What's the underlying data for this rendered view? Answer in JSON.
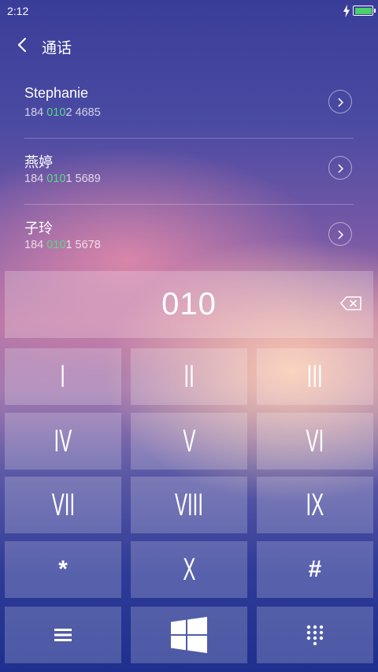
{
  "status": {
    "time": "2:12"
  },
  "header": {
    "title": "通话"
  },
  "contacts": [
    {
      "name": "Stephanie",
      "number_prefix": "184 ",
      "number_match": "010",
      "number_suffix": "2 4685"
    },
    {
      "name": "燕婷",
      "number_prefix": "184 ",
      "number_match": "010",
      "number_suffix": "1 5689"
    },
    {
      "name": "子玲",
      "number_prefix": "184 ",
      "number_match": "010",
      "number_suffix": "1 5678"
    }
  ],
  "dial": {
    "input": "010"
  },
  "keys": [
    "I",
    "II",
    "III",
    "IV",
    "V",
    "VI",
    "VII",
    "VIII",
    "IX",
    "*",
    "X",
    "#"
  ],
  "icons": {
    "back": "chevron-left-icon",
    "detail": "chevron-right-icon",
    "backspace": "backspace-icon",
    "menu": "menu-icon",
    "windows": "windows-logo-icon",
    "dialpad": "dialpad-icon"
  },
  "colors": {
    "match_highlight": "#58d88a",
    "battery": "#4bd06b"
  }
}
